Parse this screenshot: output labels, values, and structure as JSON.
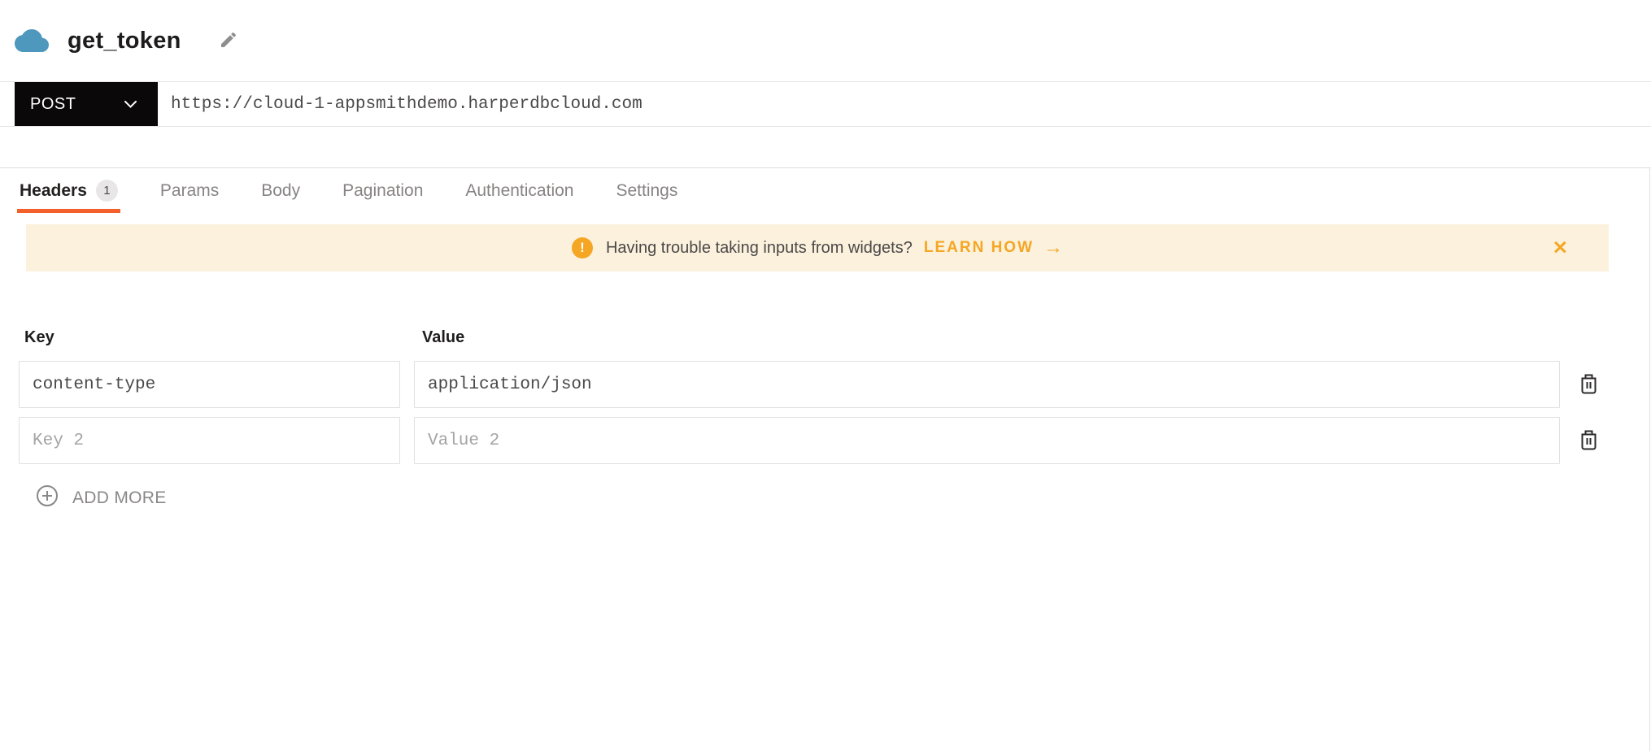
{
  "header": {
    "title": "get_token"
  },
  "request_bar": {
    "method": "POST",
    "url": "https://cloud-1-appsmithdemo.harperdbcloud.com"
  },
  "tabs": [
    {
      "label": "Headers",
      "badge": "1",
      "active": true
    },
    {
      "label": "Params",
      "active": false
    },
    {
      "label": "Body",
      "active": false
    },
    {
      "label": "Pagination",
      "active": false
    },
    {
      "label": "Authentication",
      "active": false
    },
    {
      "label": "Settings",
      "active": false
    }
  ],
  "banner": {
    "warning_glyph": "!",
    "message": "Having trouble taking inputs from widgets?",
    "link_label": "LEARN HOW",
    "arrow_glyph": "→",
    "close_glyph": "✕"
  },
  "headers_form": {
    "key_column_label": "Key",
    "value_column_label": "Value",
    "rows": [
      {
        "key": "content-type",
        "value": "application/json"
      },
      {
        "key_placeholder": "Key 2",
        "value_placeholder": "Value 2"
      }
    ],
    "add_more_label": "ADD MORE"
  },
  "colors": {
    "accent_orange": "#F3602B",
    "warning_yellow": "#F5A623",
    "banner_bg": "#FBF1DC",
    "method_button_bg": "#0A0808",
    "cloud_blue": "#4E97BD"
  }
}
